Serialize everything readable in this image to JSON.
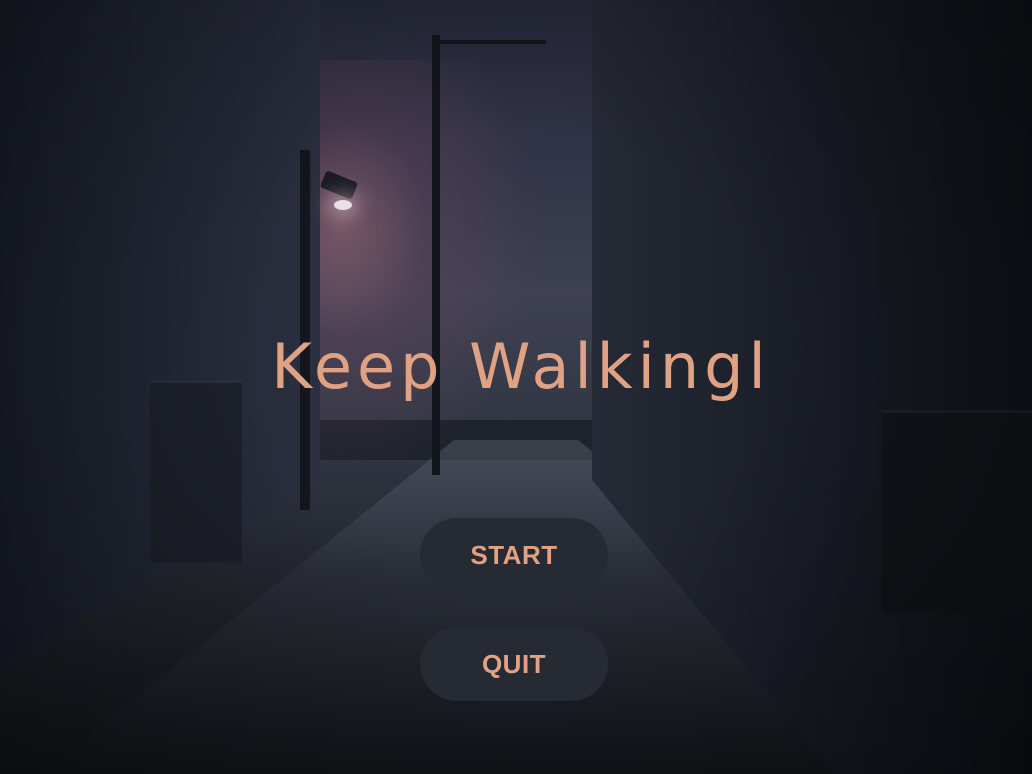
{
  "game": {
    "title": "Keep Walkingl"
  },
  "menu": {
    "start_label": "START",
    "quit_label": "QUIT"
  },
  "colors": {
    "accent": "#e0a283",
    "button_bg": "#262a33",
    "background": "#1a1f2b"
  }
}
